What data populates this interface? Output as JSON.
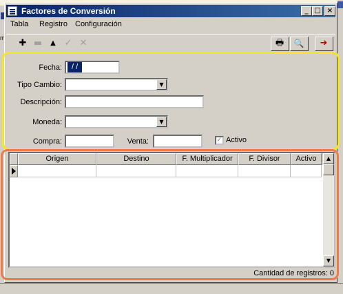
{
  "window": {
    "title": "Factores de Conversión",
    "controls": {
      "minimize": "_",
      "maximize": "□",
      "close": "×"
    }
  },
  "menu": [
    "Tabla",
    "Registro",
    "Configuración"
  ],
  "toolbar": {
    "left_tools": [
      {
        "icon": "plus-icon",
        "glyph": "✚",
        "enabled": true
      },
      {
        "icon": "minus-icon",
        "glyph": "▬",
        "enabled": false
      },
      {
        "icon": "up-triangle-icon",
        "glyph": "▲",
        "enabled": true
      },
      {
        "icon": "check-icon",
        "glyph": "✓",
        "enabled": false
      },
      {
        "icon": "cancel-x-icon",
        "glyph": "✕",
        "enabled": false
      }
    ],
    "right_tools": [
      {
        "icon": "printer-icon",
        "glyph": "🖶"
      },
      {
        "icon": "search-icon",
        "glyph": "🔍"
      },
      {
        "icon": "exit-arrow-icon",
        "glyph": "➜",
        "color": "#cc0000"
      }
    ]
  },
  "form": {
    "fecha_label": "Fecha:",
    "fecha_value": "/  /",
    "tipo_cambio_label": "Tipo Cambio:",
    "tipo_cambio_value": "",
    "descripcion_label": "Descripción:",
    "descripcion_value": "",
    "moneda_label": "Moneda:",
    "moneda_value": "",
    "compra_label": "Compra:",
    "compra_value": "",
    "venta_label": "Venta:",
    "venta_value": "",
    "activo_label": "Activo",
    "activo_checked": true
  },
  "grid": {
    "columns": [
      "Origen",
      "Destino",
      "F. Multiplicador",
      "F. Divisor",
      "Activo"
    ],
    "rows": [
      [
        "",
        "",
        "",
        "",
        ""
      ]
    ]
  },
  "status": {
    "record_count_text": "Cantidad de registros: 0"
  },
  "background": {
    "left_text": "mi"
  },
  "colors": {
    "titlebar_start": "#0a246a",
    "titlebar_end": "#3a6ea5",
    "highlight_form": "#f5e71e",
    "highlight_grid": "#f07b4a"
  }
}
